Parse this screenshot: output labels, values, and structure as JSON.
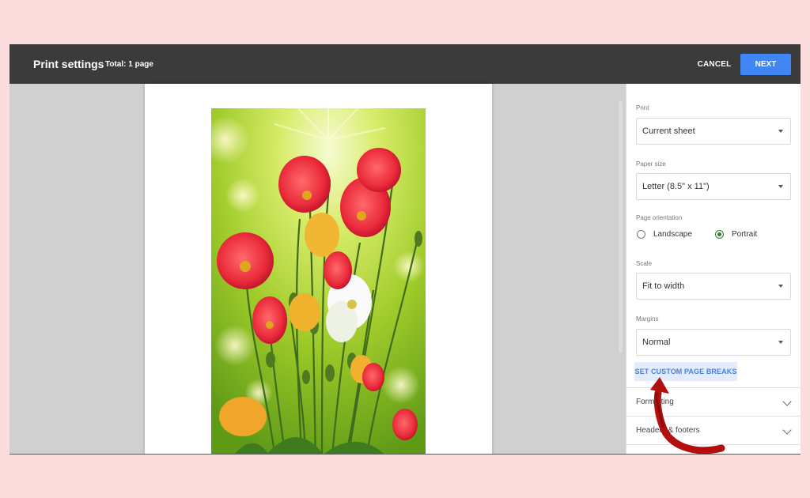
{
  "header": {
    "title": "Print settings",
    "subtitle": "Total: 1 page",
    "cancel_label": "CANCEL",
    "next_label": "NEXT"
  },
  "panel": {
    "print": {
      "label": "Print",
      "value": "Current sheet"
    },
    "paper_size": {
      "label": "Paper size",
      "value": "Letter (8.5\" x 11\")"
    },
    "orientation": {
      "label": "Page orientation",
      "options": [
        "Landscape",
        "Portrait"
      ],
      "selected": "Portrait"
    },
    "scale": {
      "label": "Scale",
      "value": "Fit to width"
    },
    "margins": {
      "label": "Margins",
      "value": "Normal"
    },
    "custom_breaks_label": "SET CUSTOM PAGE BREAKS",
    "sections": [
      "Formatting",
      "Headers & footers"
    ]
  },
  "colors": {
    "accent": "#4285f4",
    "topbar": "#3b3b3b",
    "annotation_arrow": "#b30f0f",
    "radio_selected": "#2e7d32"
  }
}
